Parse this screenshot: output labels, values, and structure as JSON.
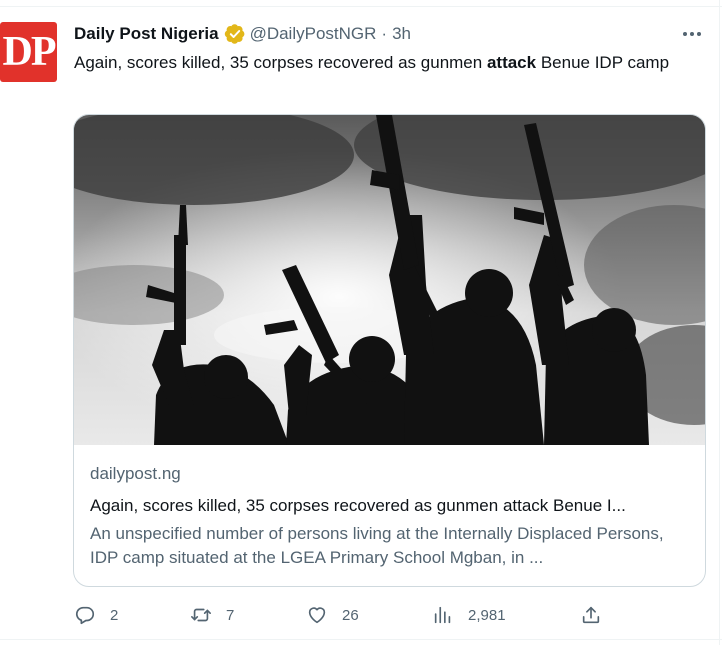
{
  "account": {
    "avatar_text": "DP",
    "display_name": "Daily Post Nigeria",
    "handle": "@DailyPostNGR",
    "separator": "·",
    "time": "3h",
    "verified_icon": "verified-badge-gold",
    "avatar_color": "#e1322b"
  },
  "tweet": {
    "text_before": "Again, scores killed, 35 corpses recovered as gunmen ",
    "text_bold": "attack",
    "text_after": " Benue IDP camp"
  },
  "card": {
    "domain": "dailypost.ng",
    "title": "Again, scores killed, 35 corpses recovered as gunmen attack Benue I...",
    "description": "An unspecified number of persons living at the Internally Displaced Persons, IDP camp situated at the LGEA Primary School Mgban, in ..."
  },
  "actions": {
    "replies": "2",
    "retweets": "7",
    "likes": "26",
    "views": "2,981"
  },
  "colors": {
    "text": "#0f1419",
    "secondary": "#536471",
    "border": "#cfd9de",
    "verified": "#e2b719"
  }
}
